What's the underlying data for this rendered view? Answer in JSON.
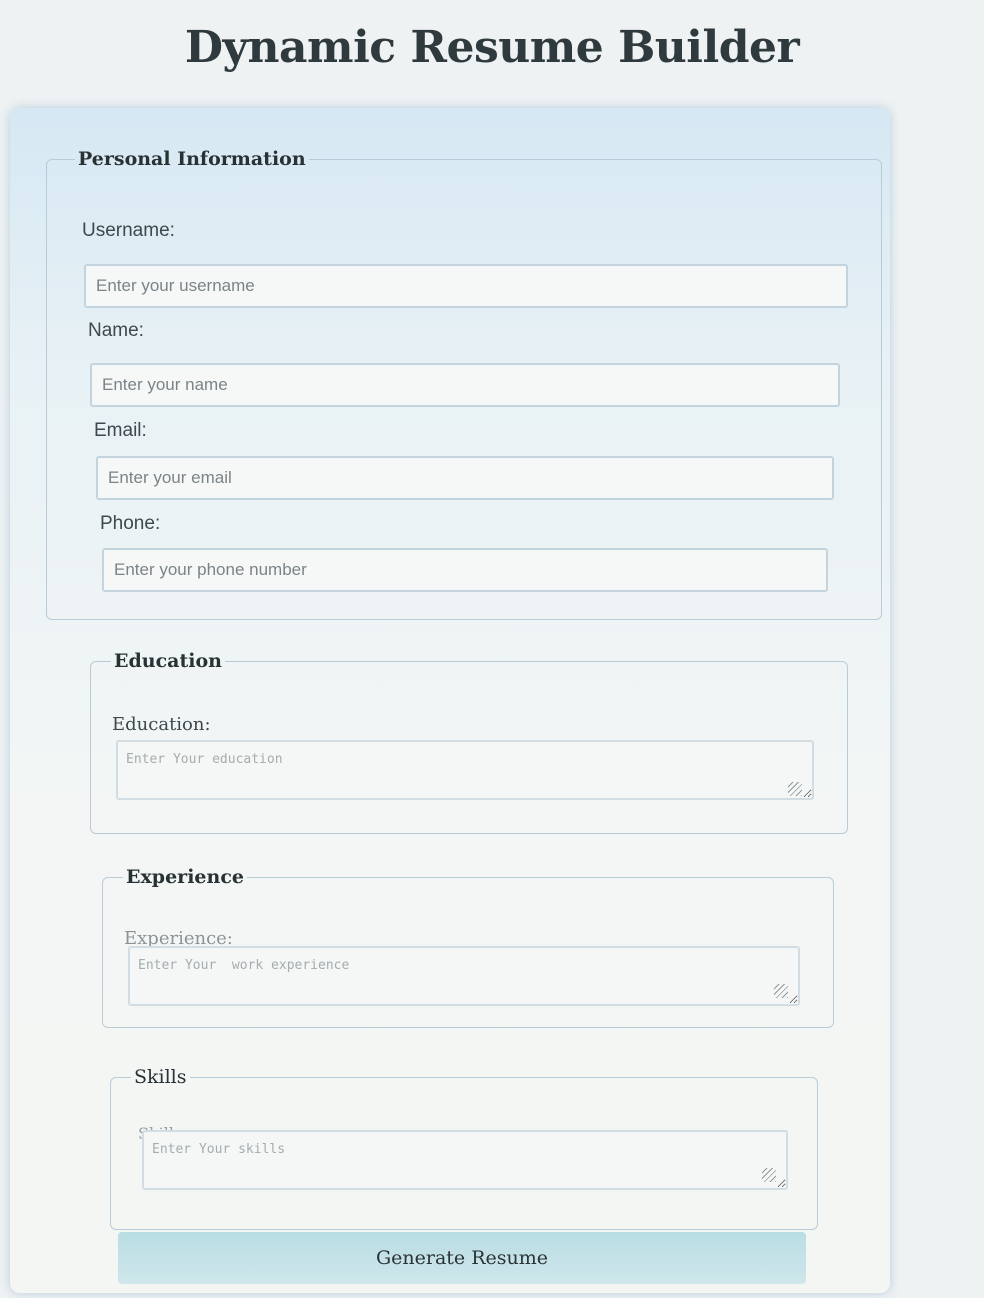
{
  "page": {
    "title": "Dynamic Resume Builder"
  },
  "personal": {
    "legend": "Personal Information",
    "username_label": "Username:",
    "username_placeholder": "Enter your username",
    "name_label": "Name:",
    "name_placeholder": "Enter your name",
    "email_label": "Email:",
    "email_placeholder": "Enter your email",
    "phone_label": "Phone:",
    "phone_placeholder": "Enter your phone number"
  },
  "education": {
    "legend": "Education",
    "label": "Education:",
    "placeholder": "Enter Your education"
  },
  "experience": {
    "legend": "Experience",
    "label": "Experience:",
    "placeholder": "Enter Your  work experience"
  },
  "skills": {
    "legend": "Skills",
    "label": "Skills:",
    "placeholder": "Enter Your skills"
  },
  "actions": {
    "generate_label": "Generate Resume"
  },
  "colors": {
    "card_top": "#d6e8f4",
    "button": "#b9dde4",
    "border": "#c4d4de"
  }
}
